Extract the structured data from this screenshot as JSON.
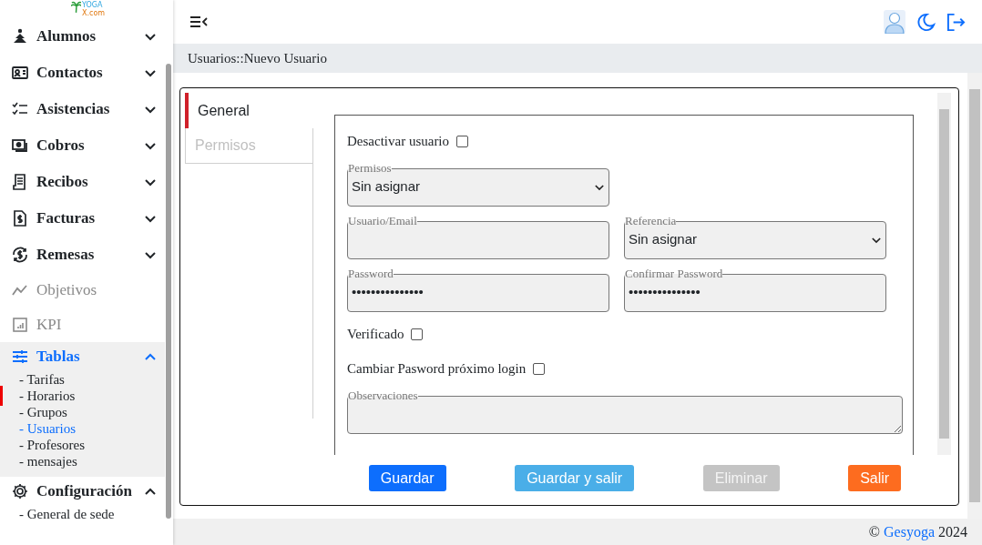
{
  "logo": {
    "line1": "YOGA",
    "line2": "X.com"
  },
  "sidebar": {
    "items": [
      {
        "kind": "group",
        "label": "Alumnos",
        "expanded": false,
        "disabled": false,
        "selected": false
      },
      {
        "kind": "group",
        "label": "Contactos",
        "expanded": false,
        "disabled": false,
        "selected": false
      },
      {
        "kind": "group",
        "label": "Asistencias",
        "expanded": false,
        "disabled": false,
        "selected": false
      },
      {
        "kind": "group",
        "label": "Cobros",
        "expanded": false,
        "disabled": false,
        "selected": false
      },
      {
        "kind": "group",
        "label": "Recibos",
        "expanded": false,
        "disabled": false,
        "selected": false
      },
      {
        "kind": "group",
        "label": "Facturas",
        "expanded": false,
        "disabled": false,
        "selected": false
      },
      {
        "kind": "group",
        "label": "Remesas",
        "expanded": false,
        "disabled": false,
        "selected": false
      },
      {
        "kind": "link",
        "label": "Objetivos",
        "disabled": true,
        "selected": false
      },
      {
        "kind": "link",
        "label": "KPI",
        "disabled": true,
        "selected": false
      },
      {
        "kind": "group",
        "label": "Tablas",
        "expanded": true,
        "disabled": false,
        "selected": true,
        "children": [
          {
            "label": "- Tarifas",
            "selected": false
          },
          {
            "label": "- Horarios",
            "selected": false
          },
          {
            "label": "- Grupos",
            "selected": false
          },
          {
            "label": "- Usuarios",
            "selected": true
          },
          {
            "label": "- Profesores",
            "selected": false
          },
          {
            "label": "- mensajes",
            "selected": false
          }
        ]
      },
      {
        "kind": "group",
        "label": "Configuración",
        "expanded": true,
        "disabled": false,
        "selected": false,
        "children": [
          {
            "label": "- General de sede",
            "selected": false
          }
        ]
      }
    ]
  },
  "breadcrumb": "Usuarios::Nuevo Usuario",
  "tabs": [
    {
      "label": "General",
      "selected": true
    },
    {
      "label": "Permisos",
      "selected": false
    }
  ],
  "form": {
    "rows": [
      {
        "fields": [
          {
            "kind": "checkbox",
            "label": "Desactivar usuario",
            "checked": false
          }
        ]
      },
      {
        "fields": [
          {
            "kind": "select",
            "label": "Permisos",
            "value": "Sin asignar"
          }
        ]
      },
      {
        "fields": [
          {
            "kind": "text",
            "label": "Usuario/Email"
          },
          {
            "kind": "select",
            "label": "Referencia",
            "value": "Sin asignar"
          }
        ]
      },
      {
        "fields": [
          {
            "kind": "text",
            "label": "Password",
            "value": "•••••••••••••••"
          },
          {
            "kind": "text",
            "label": "Confirmar Password",
            "value": "•••••••••••••••"
          }
        ]
      },
      {
        "fields": [
          {
            "kind": "checkbox",
            "label": "Verificado",
            "checked": false
          }
        ]
      },
      {
        "fields": [
          {
            "kind": "checkbox",
            "label": "Cambiar Pasword próximo login",
            "checked": false
          }
        ]
      },
      {
        "fields": [
          {
            "kind": "textarea",
            "label": "Observaciones"
          }
        ]
      }
    ]
  },
  "buttons": [
    {
      "label": "Guardar",
      "kind": "primary"
    },
    {
      "label": "Guardar y salir",
      "kind": "info"
    },
    {
      "label": "Eliminar",
      "kind": "secondary"
    },
    {
      "label": "Salir",
      "kind": "danger"
    }
  ],
  "footer": {
    "copyright": "©",
    "link": "Gesyoga",
    "year": "2024"
  }
}
